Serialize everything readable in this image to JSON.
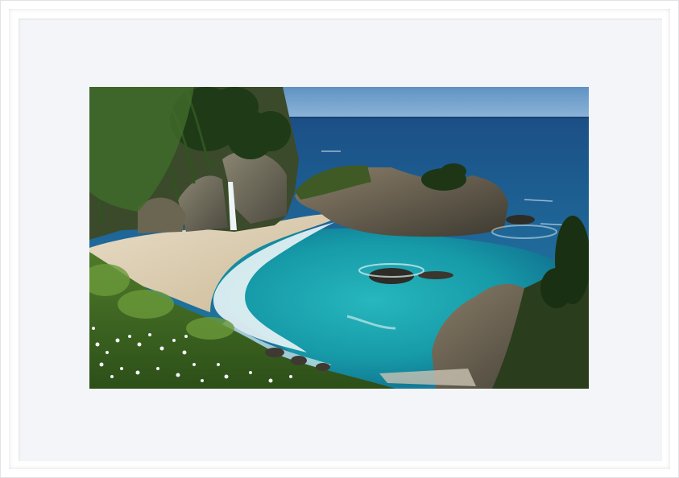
{
  "frame": {
    "frame_color": "#ffffff",
    "mat_color": "#f4f5f8"
  },
  "photo": {
    "subject": "coastal-cove-waterfall",
    "colors": {
      "sky": "#6f9ec9",
      "ocean_deep": "#1d5f8e",
      "cove_turquoise": "#1fa3b0",
      "sand": "#ddd0b5",
      "rock": "#6d6a5e",
      "foliage": "#2f5a22"
    }
  }
}
